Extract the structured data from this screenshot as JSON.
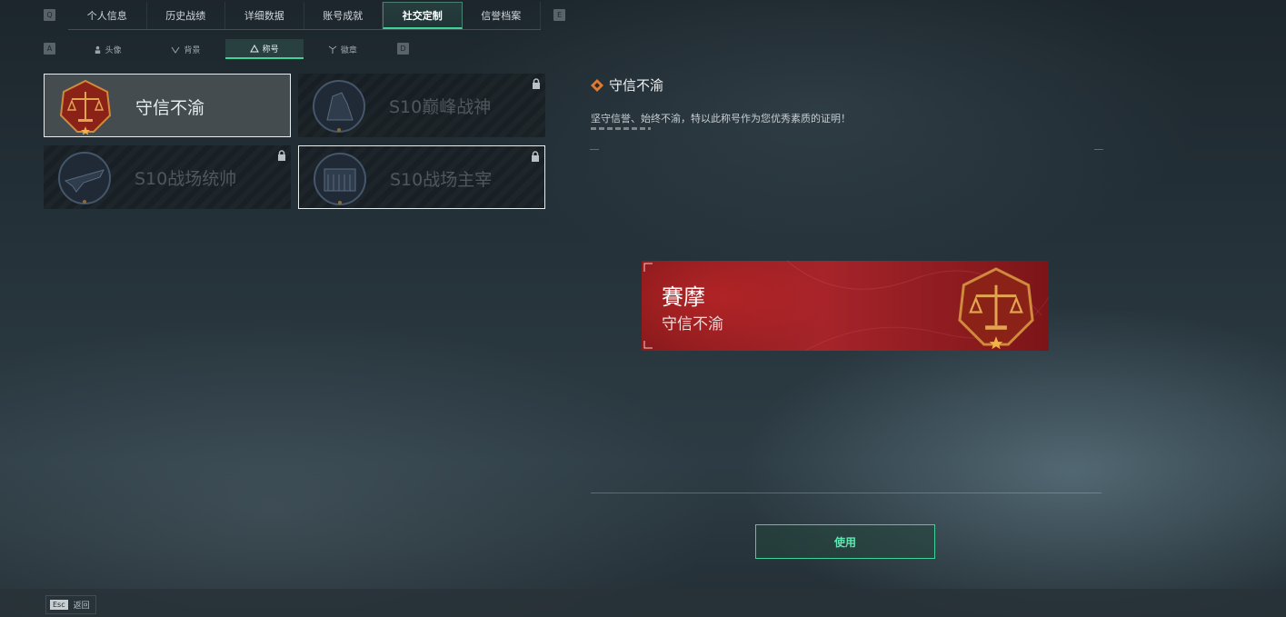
{
  "top_nav": {
    "left_key": "Q",
    "right_key": "E",
    "tabs": [
      {
        "label": "个人信息"
      },
      {
        "label": "历史战绩"
      },
      {
        "label": "详细数据"
      },
      {
        "label": "账号成就"
      },
      {
        "label": "社交定制",
        "active": true
      },
      {
        "label": "信誉档案"
      }
    ]
  },
  "sub_nav": {
    "left_key": "A",
    "right_key": "D",
    "tabs": [
      {
        "label": "头像",
        "icon": "person-icon"
      },
      {
        "label": "背景",
        "icon": "frame-icon"
      },
      {
        "label": "称号",
        "icon": "triangle-icon",
        "active": true
      },
      {
        "label": "徽章",
        "icon": "badge-icon"
      }
    ]
  },
  "titles": [
    {
      "label": "守信不渝",
      "selected": true,
      "locked": false,
      "emblem": "scales-emblem-icon"
    },
    {
      "label": "S10巅峰战神",
      "selected": false,
      "locked": true,
      "emblem": "soldier-emblem-icon"
    },
    {
      "label": "S10战场统帅",
      "selected": false,
      "locked": true,
      "emblem": "aircraft-emblem-icon"
    },
    {
      "label": "S10战场主宰",
      "selected": false,
      "locked": true,
      "emblem": "colosseum-emblem-icon"
    }
  ],
  "detail": {
    "title": "守信不渝",
    "description": "坚守信誉、始终不渝，特以此称号作为您优秀素质的证明！"
  },
  "preview": {
    "player_name": "賽摩",
    "title": "守信不渝"
  },
  "use_button": {
    "label": "使用"
  },
  "footer": {
    "key": "Esc",
    "label": "返回"
  },
  "colors": {
    "accent": "#3fd39a",
    "banner": "#a5242a"
  }
}
